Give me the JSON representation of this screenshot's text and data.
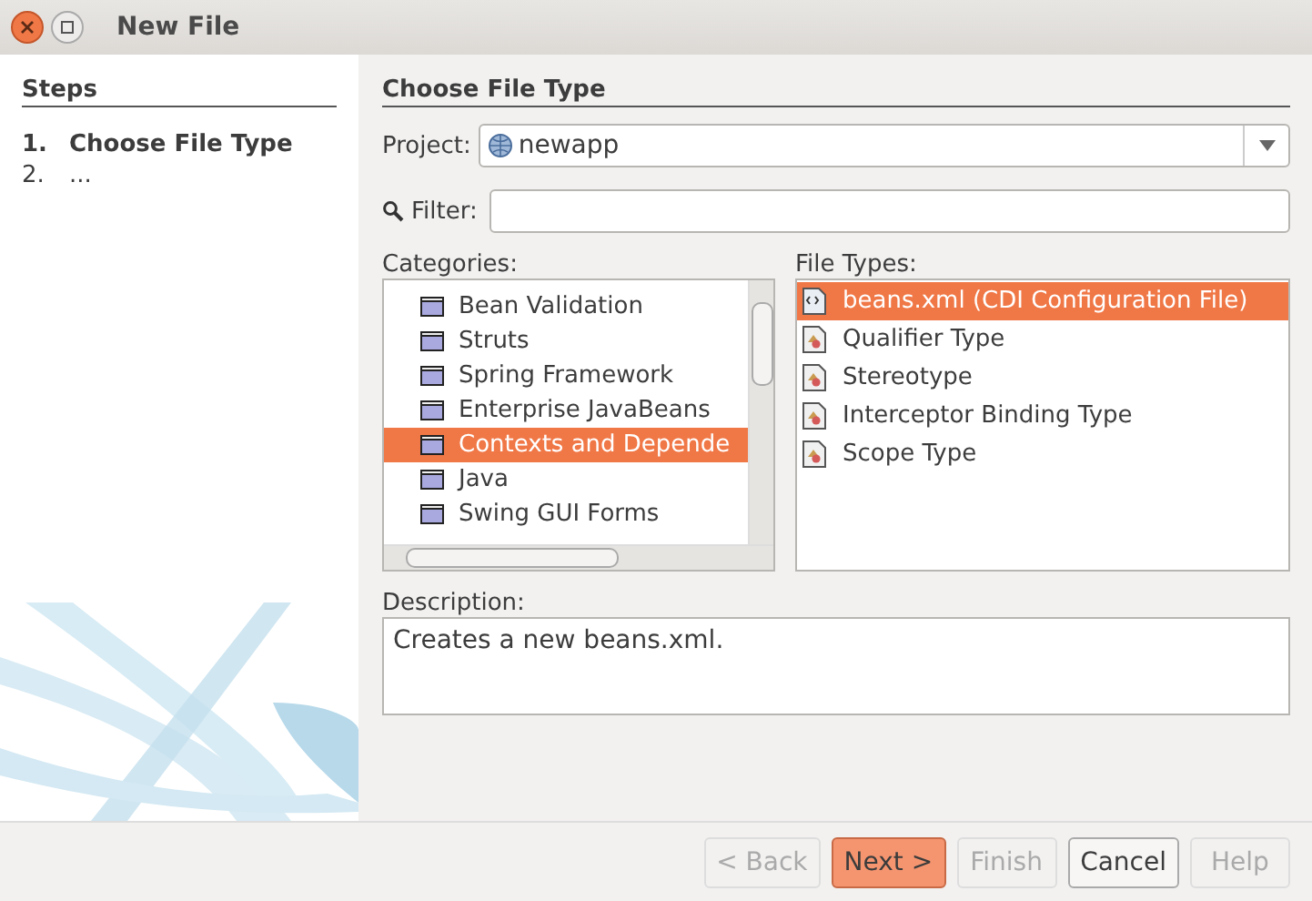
{
  "window": {
    "title": "New File"
  },
  "steps": {
    "heading": "Steps",
    "items": [
      {
        "number": "1.",
        "label": "Choose File Type",
        "selected": true
      },
      {
        "number": "2.",
        "label": "...",
        "selected": false
      }
    ]
  },
  "main": {
    "heading": "Choose File Type",
    "project": {
      "label": "Project:",
      "value": "newapp"
    },
    "filter": {
      "label": "Filter:"
    },
    "categories": {
      "label": "Categories:",
      "items": [
        {
          "label": "Bean Validation",
          "selected": false
        },
        {
          "label": "Struts",
          "selected": false
        },
        {
          "label": "Spring Framework",
          "selected": false
        },
        {
          "label": "Enterprise JavaBeans",
          "selected": false
        },
        {
          "label": "Contexts and Depende",
          "selected": true
        },
        {
          "label": "Java",
          "selected": false
        },
        {
          "label": "Swing GUI Forms",
          "selected": false
        }
      ]
    },
    "file_types": {
      "label": "File Types:",
      "items": [
        {
          "label": "beans.xml (CDI Configuration File)",
          "kind": "xml",
          "selected": true
        },
        {
          "label": "Qualifier Type",
          "kind": "class",
          "selected": false
        },
        {
          "label": "Stereotype",
          "kind": "class",
          "selected": false
        },
        {
          "label": "Interceptor Binding Type",
          "kind": "class",
          "selected": false
        },
        {
          "label": "Scope Type",
          "kind": "class",
          "selected": false
        }
      ]
    },
    "description": {
      "label": "Description:",
      "text": "Creates a new beans.xml."
    }
  },
  "buttons": [
    {
      "label": "< Back",
      "disabled": true,
      "default": false
    },
    {
      "label": "Next >",
      "disabled": false,
      "default": true
    },
    {
      "label": "Finish",
      "disabled": true,
      "default": false
    },
    {
      "label": "Cancel",
      "disabled": false,
      "default": false
    },
    {
      "label": "Help",
      "disabled": true,
      "default": false
    }
  ]
}
